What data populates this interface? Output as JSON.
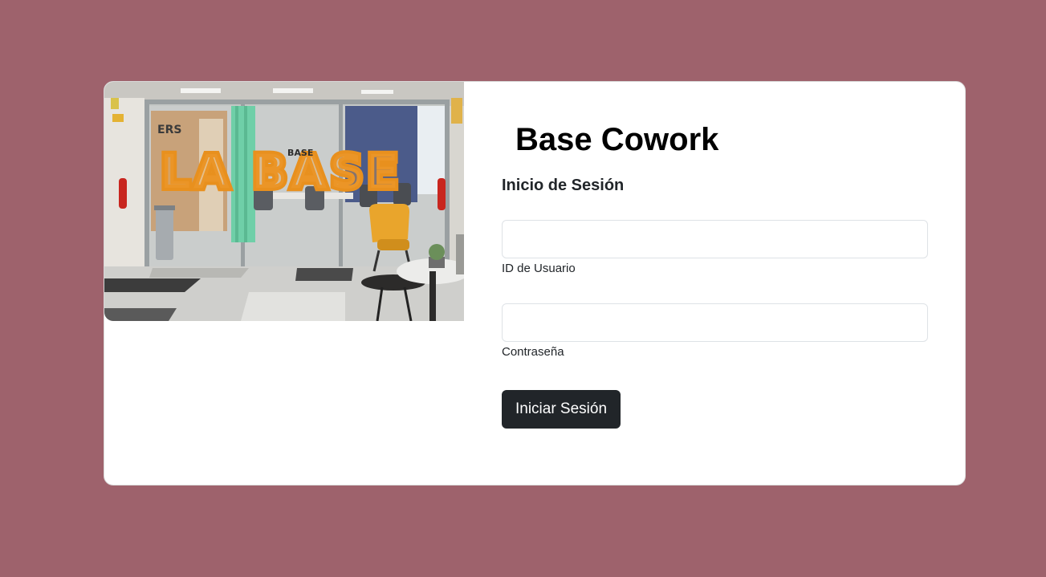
{
  "page": {
    "background_color": "#9e626c"
  },
  "hero_image": {
    "description_icon": "coworking-office-photo",
    "wall_letters": "LA BASE",
    "sign_text": "BASE",
    "door_text": "ERS"
  },
  "login": {
    "brand": "Base Cowork",
    "subtitle": "Inicio de Sesión",
    "user_field": {
      "value": "",
      "placeholder": "",
      "label": "ID de Usuario"
    },
    "password_field": {
      "value": "",
      "placeholder": "",
      "label": "Contraseña"
    },
    "submit_label": "Iniciar Sesión",
    "button_color": "#212529"
  }
}
